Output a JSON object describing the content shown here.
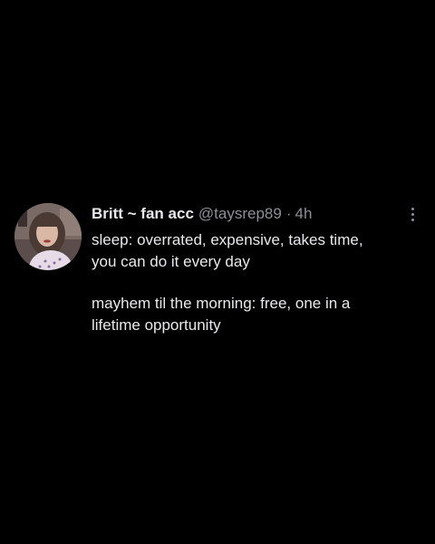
{
  "tweet": {
    "display_name": "Britt ~ fan acc",
    "handle": "@taysrep89",
    "separator": "·",
    "time": "4h",
    "more_icon": "more-vertical-icon",
    "paragraphs": [
      [
        "sleep: overrated, expensive, takes time,",
        "you can do it every day"
      ],
      [
        "mayhem til the morning: free, one in a",
        "lifetime opportunity"
      ]
    ]
  },
  "colors": {
    "background": "#000000",
    "text": "#e7e9ea",
    "muted": "#8b9096"
  }
}
